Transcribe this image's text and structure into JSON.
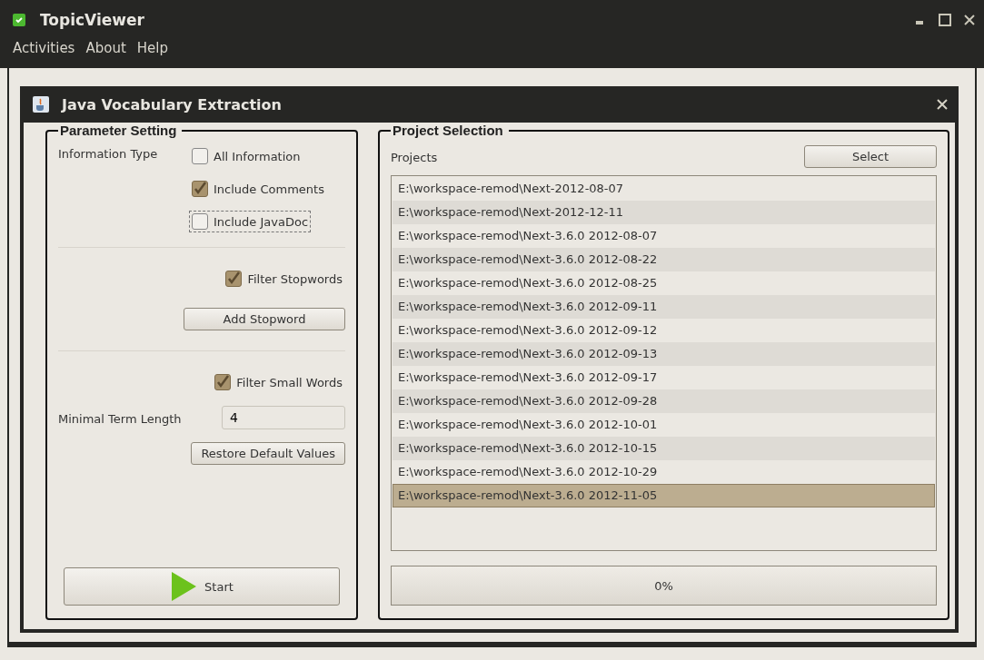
{
  "window": {
    "title": "TopicViewer"
  },
  "menu": [
    {
      "label": "Activities"
    },
    {
      "label": "About"
    },
    {
      "label": "Help"
    }
  ],
  "dialog": {
    "title": "Java Vocabulary Extraction"
  },
  "parameters": {
    "title": "Parameter Setting",
    "information_type_label": "Information Type",
    "info_options": [
      {
        "label": "All Information",
        "checked": false,
        "focused": false
      },
      {
        "label": "Include Comments",
        "checked": true,
        "focused": false
      },
      {
        "label": "Include JavaDoc",
        "checked": false,
        "focused": true
      }
    ],
    "filter_stopwords": {
      "label": "Filter Stopwords",
      "checked": true
    },
    "add_stopword_button": "Add Stopword",
    "filter_small_words": {
      "label": "Filter Small Words",
      "checked": true
    },
    "min_term_length": {
      "label": "Minimal Term Length",
      "value": "4"
    },
    "restore_button": "Restore Default Values",
    "start_button": "Start"
  },
  "projects": {
    "title": "Project Selection",
    "label": "Projects",
    "select_button": "Select",
    "items": [
      {
        "path": "E:\\workspace-remod\\Next-2012-08-07",
        "selected": false
      },
      {
        "path": "E:\\workspace-remod\\Next-2012-12-11",
        "selected": false
      },
      {
        "path": "E:\\workspace-remod\\Next-3.6.0 2012-08-07",
        "selected": false
      },
      {
        "path": "E:\\workspace-remod\\Next-3.6.0 2012-08-22",
        "selected": false
      },
      {
        "path": "E:\\workspace-remod\\Next-3.6.0 2012-08-25",
        "selected": false
      },
      {
        "path": "E:\\workspace-remod\\Next-3.6.0 2012-09-11",
        "selected": false
      },
      {
        "path": "E:\\workspace-remod\\Next-3.6.0 2012-09-12",
        "selected": false
      },
      {
        "path": "E:\\workspace-remod\\Next-3.6.0 2012-09-13",
        "selected": false
      },
      {
        "path": "E:\\workspace-remod\\Next-3.6.0 2012-09-17",
        "selected": false
      },
      {
        "path": "E:\\workspace-remod\\Next-3.6.0 2012-09-28",
        "selected": false
      },
      {
        "path": "E:\\workspace-remod\\Next-3.6.0 2012-10-01",
        "selected": false
      },
      {
        "path": "E:\\workspace-remod\\Next-3.6.0 2012-10-15",
        "selected": false
      },
      {
        "path": "E:\\workspace-remod\\Next-3.6.0 2012-10-29",
        "selected": false
      },
      {
        "path": "E:\\workspace-remod\\Next-3.6.0 2012-11-05",
        "selected": true
      }
    ],
    "progress": {
      "level": 0,
      "label": "0%"
    }
  }
}
